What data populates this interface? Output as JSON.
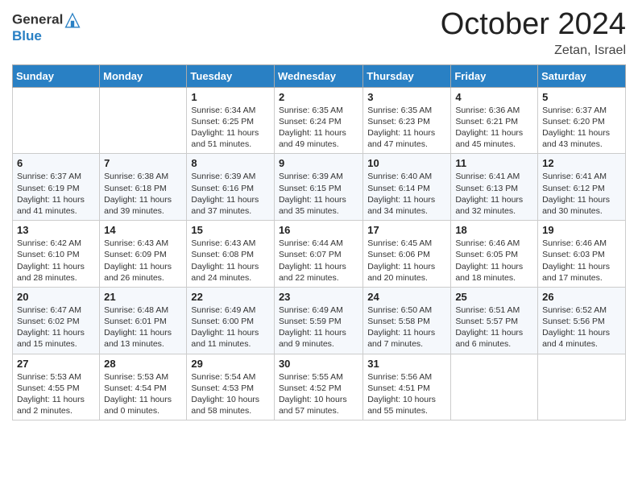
{
  "logo": {
    "general": "General",
    "blue": "Blue"
  },
  "header": {
    "month": "October 2024",
    "location": "Zetan, Israel"
  },
  "days_of_week": [
    "Sunday",
    "Monday",
    "Tuesday",
    "Wednesday",
    "Thursday",
    "Friday",
    "Saturday"
  ],
  "weeks": [
    [
      {
        "day": "",
        "info": ""
      },
      {
        "day": "",
        "info": ""
      },
      {
        "day": "1",
        "sunrise": "Sunrise: 6:34 AM",
        "sunset": "Sunset: 6:25 PM",
        "daylight": "Daylight: 11 hours and 51 minutes."
      },
      {
        "day": "2",
        "sunrise": "Sunrise: 6:35 AM",
        "sunset": "Sunset: 6:24 PM",
        "daylight": "Daylight: 11 hours and 49 minutes."
      },
      {
        "day": "3",
        "sunrise": "Sunrise: 6:35 AM",
        "sunset": "Sunset: 6:23 PM",
        "daylight": "Daylight: 11 hours and 47 minutes."
      },
      {
        "day": "4",
        "sunrise": "Sunrise: 6:36 AM",
        "sunset": "Sunset: 6:21 PM",
        "daylight": "Daylight: 11 hours and 45 minutes."
      },
      {
        "day": "5",
        "sunrise": "Sunrise: 6:37 AM",
        "sunset": "Sunset: 6:20 PM",
        "daylight": "Daylight: 11 hours and 43 minutes."
      }
    ],
    [
      {
        "day": "6",
        "sunrise": "Sunrise: 6:37 AM",
        "sunset": "Sunset: 6:19 PM",
        "daylight": "Daylight: 11 hours and 41 minutes."
      },
      {
        "day": "7",
        "sunrise": "Sunrise: 6:38 AM",
        "sunset": "Sunset: 6:18 PM",
        "daylight": "Daylight: 11 hours and 39 minutes."
      },
      {
        "day": "8",
        "sunrise": "Sunrise: 6:39 AM",
        "sunset": "Sunset: 6:16 PM",
        "daylight": "Daylight: 11 hours and 37 minutes."
      },
      {
        "day": "9",
        "sunrise": "Sunrise: 6:39 AM",
        "sunset": "Sunset: 6:15 PM",
        "daylight": "Daylight: 11 hours and 35 minutes."
      },
      {
        "day": "10",
        "sunrise": "Sunrise: 6:40 AM",
        "sunset": "Sunset: 6:14 PM",
        "daylight": "Daylight: 11 hours and 34 minutes."
      },
      {
        "day": "11",
        "sunrise": "Sunrise: 6:41 AM",
        "sunset": "Sunset: 6:13 PM",
        "daylight": "Daylight: 11 hours and 32 minutes."
      },
      {
        "day": "12",
        "sunrise": "Sunrise: 6:41 AM",
        "sunset": "Sunset: 6:12 PM",
        "daylight": "Daylight: 11 hours and 30 minutes."
      }
    ],
    [
      {
        "day": "13",
        "sunrise": "Sunrise: 6:42 AM",
        "sunset": "Sunset: 6:10 PM",
        "daylight": "Daylight: 11 hours and 28 minutes."
      },
      {
        "day": "14",
        "sunrise": "Sunrise: 6:43 AM",
        "sunset": "Sunset: 6:09 PM",
        "daylight": "Daylight: 11 hours and 26 minutes."
      },
      {
        "day": "15",
        "sunrise": "Sunrise: 6:43 AM",
        "sunset": "Sunset: 6:08 PM",
        "daylight": "Daylight: 11 hours and 24 minutes."
      },
      {
        "day": "16",
        "sunrise": "Sunrise: 6:44 AM",
        "sunset": "Sunset: 6:07 PM",
        "daylight": "Daylight: 11 hours and 22 minutes."
      },
      {
        "day": "17",
        "sunrise": "Sunrise: 6:45 AM",
        "sunset": "Sunset: 6:06 PM",
        "daylight": "Daylight: 11 hours and 20 minutes."
      },
      {
        "day": "18",
        "sunrise": "Sunrise: 6:46 AM",
        "sunset": "Sunset: 6:05 PM",
        "daylight": "Daylight: 11 hours and 18 minutes."
      },
      {
        "day": "19",
        "sunrise": "Sunrise: 6:46 AM",
        "sunset": "Sunset: 6:03 PM",
        "daylight": "Daylight: 11 hours and 17 minutes."
      }
    ],
    [
      {
        "day": "20",
        "sunrise": "Sunrise: 6:47 AM",
        "sunset": "Sunset: 6:02 PM",
        "daylight": "Daylight: 11 hours and 15 minutes."
      },
      {
        "day": "21",
        "sunrise": "Sunrise: 6:48 AM",
        "sunset": "Sunset: 6:01 PM",
        "daylight": "Daylight: 11 hours and 13 minutes."
      },
      {
        "day": "22",
        "sunrise": "Sunrise: 6:49 AM",
        "sunset": "Sunset: 6:00 PM",
        "daylight": "Daylight: 11 hours and 11 minutes."
      },
      {
        "day": "23",
        "sunrise": "Sunrise: 6:49 AM",
        "sunset": "Sunset: 5:59 PM",
        "daylight": "Daylight: 11 hours and 9 minutes."
      },
      {
        "day": "24",
        "sunrise": "Sunrise: 6:50 AM",
        "sunset": "Sunset: 5:58 PM",
        "daylight": "Daylight: 11 hours and 7 minutes."
      },
      {
        "day": "25",
        "sunrise": "Sunrise: 6:51 AM",
        "sunset": "Sunset: 5:57 PM",
        "daylight": "Daylight: 11 hours and 6 minutes."
      },
      {
        "day": "26",
        "sunrise": "Sunrise: 6:52 AM",
        "sunset": "Sunset: 5:56 PM",
        "daylight": "Daylight: 11 hours and 4 minutes."
      }
    ],
    [
      {
        "day": "27",
        "sunrise": "Sunrise: 5:53 AM",
        "sunset": "Sunset: 4:55 PM",
        "daylight": "Daylight: 11 hours and 2 minutes."
      },
      {
        "day": "28",
        "sunrise": "Sunrise: 5:53 AM",
        "sunset": "Sunset: 4:54 PM",
        "daylight": "Daylight: 11 hours and 0 minutes."
      },
      {
        "day": "29",
        "sunrise": "Sunrise: 5:54 AM",
        "sunset": "Sunset: 4:53 PM",
        "daylight": "Daylight: 10 hours and 58 minutes."
      },
      {
        "day": "30",
        "sunrise": "Sunrise: 5:55 AM",
        "sunset": "Sunset: 4:52 PM",
        "daylight": "Daylight: 10 hours and 57 minutes."
      },
      {
        "day": "31",
        "sunrise": "Sunrise: 5:56 AM",
        "sunset": "Sunset: 4:51 PM",
        "daylight": "Daylight: 10 hours and 55 minutes."
      },
      {
        "day": "",
        "info": ""
      },
      {
        "day": "",
        "info": ""
      }
    ]
  ]
}
